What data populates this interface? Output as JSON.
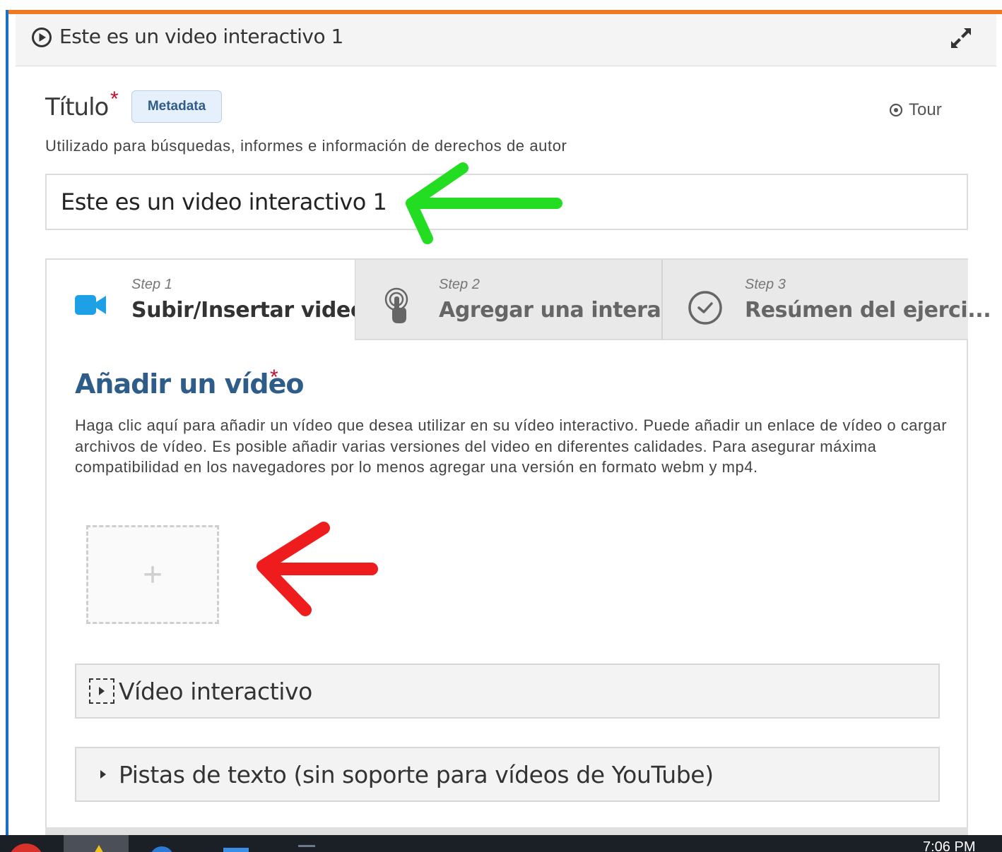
{
  "header": {
    "title": "Este es un video interactivo 1"
  },
  "title_field": {
    "label": "Título",
    "required_marker": "*",
    "metadata_label": "Metadata",
    "tour_label": "Tour",
    "description": "Utilizado para búsquedas, informes e información de derechos de autor",
    "value": "Este es un video interactivo 1"
  },
  "steps": [
    {
      "number": "Step 1",
      "name": "Subir/Insertar video",
      "active": true,
      "icon": "video-camera-icon"
    },
    {
      "number": "Step 2",
      "name": "Agregar una intera...",
      "active": false,
      "icon": "touch-pointer-icon"
    },
    {
      "number": "Step 3",
      "name": "Resúmen del ejerci...",
      "active": false,
      "icon": "check-circle-icon"
    }
  ],
  "add_video": {
    "heading": "Añadir un vídeo",
    "required_marker": "*",
    "description": "Haga clic aquí para añadir un vídeo que desea utilizar en su vídeo interactivo. Puede añadir un enlace de vídeo o cargar archivos de vídeo. Es posible añadir varias versiones del video en diferentes calidades. Para asegurar máxima compatibilidad en los navegadores por lo menos agregar una versión en formato webm y mp4.",
    "add_symbol": "+"
  },
  "sections": {
    "interactive_video": "Vídeo interactivo",
    "text_tracks": "Pistas de texto (sin soporte para vídeos de YouTube)"
  },
  "taskbar": {
    "clock": "7:06 PM"
  },
  "colors": {
    "accent_orange": "#f0781e",
    "accent_blue": "#1a6fc4",
    "heading_blue": "#2f5d8a",
    "video_icon_blue": "#1ea0e6",
    "required_red": "#c8102e",
    "annotation_green": "#22dd22",
    "annotation_red": "#ee1c1c"
  }
}
